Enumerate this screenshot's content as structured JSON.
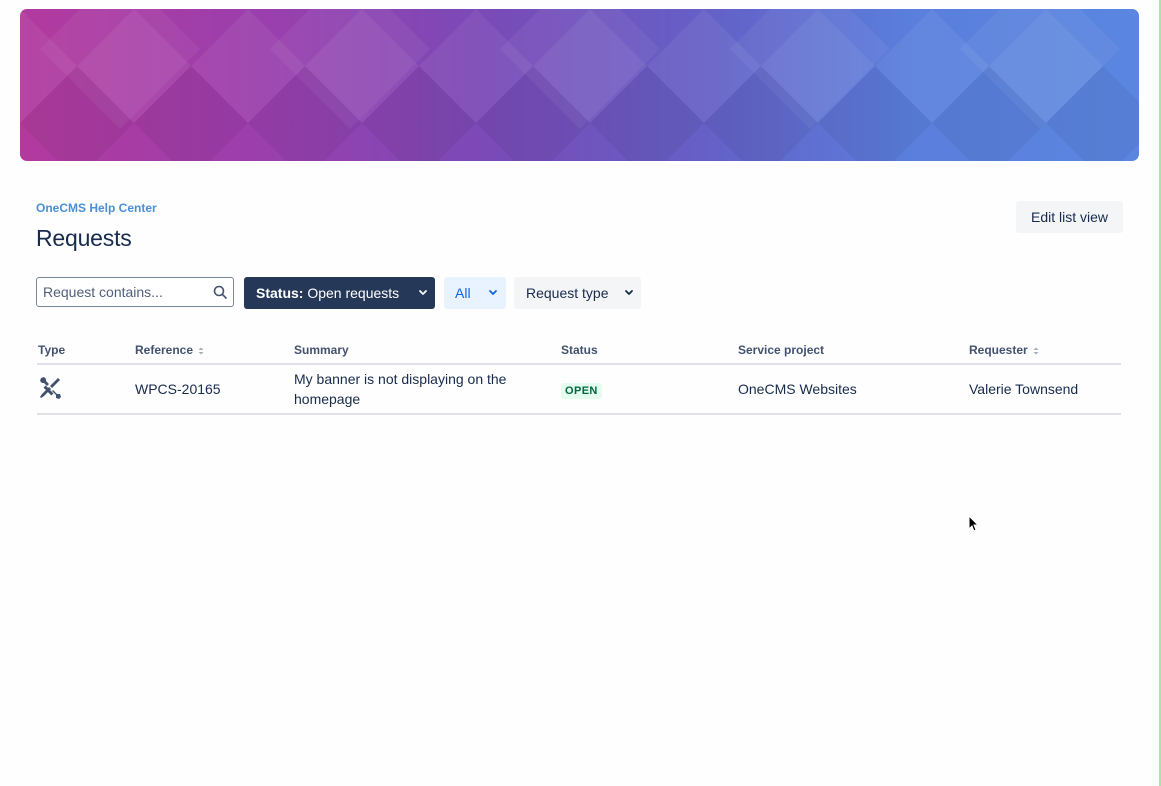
{
  "header": {
    "breadcrumb": "OneCMS Help Center",
    "title": "Requests",
    "edit_list_view_label": "Edit list view"
  },
  "filters": {
    "search": {
      "placeholder": "Request contains...",
      "value": "",
      "icon": "search-icon"
    },
    "status": {
      "prefix": "Status:",
      "value": "Open requests"
    },
    "all_label": "All",
    "request_type_label": "Request type"
  },
  "table": {
    "columns": {
      "type": "Type",
      "reference": "Reference",
      "summary": "Summary",
      "status": "Status",
      "service_project": "Service project",
      "requester": "Requester"
    },
    "rows": [
      {
        "type_icon": "wrench-screwdriver-icon",
        "reference": "WPCS-20165",
        "summary": "My banner is not displaying on the homepage",
        "status": "OPEN",
        "service_project": "OneCMS Websites",
        "requester": "Valerie Townsend"
      }
    ]
  },
  "colors": {
    "banner_start": "#b23a9e",
    "banner_end": "#5a86e0",
    "link": "#4a90d9",
    "status_button": "#253858",
    "open_lozenge_bg": "#e3fcef",
    "open_lozenge_text": "#006644"
  }
}
